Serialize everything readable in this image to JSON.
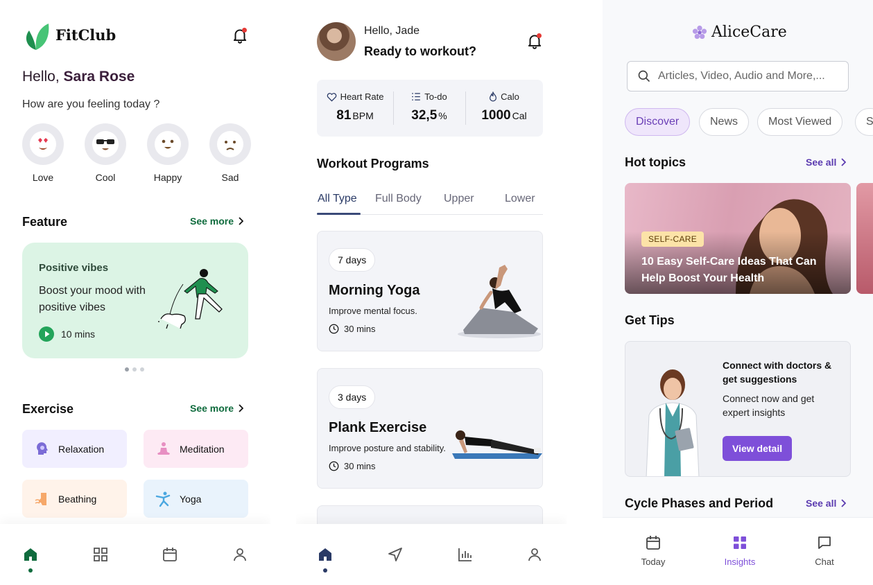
{
  "fitclub": {
    "brand": "FitClub",
    "greeting_prefix": "Hello, ",
    "user_name": "Sara Rose",
    "feeling_question": "How are you feeling today ?",
    "moods": [
      "Love",
      "Cool",
      "Happy",
      "Sad"
    ],
    "feature": {
      "section_title": "Feature",
      "see_more": "See more",
      "card_title": "Positive vibes",
      "card_desc": "Boost your mood with positive vibes",
      "duration": "10 mins"
    },
    "exercise": {
      "section_title": "Exercise",
      "see_more": "See more",
      "items": [
        "Relaxation",
        "Meditation",
        "Beathing",
        "Yoga"
      ]
    },
    "colors": {
      "brand_green": "#0f6b3d",
      "feature_bg": "#dcf4e5"
    },
    "icons": [
      "leaf-logo-icon",
      "bell-icon",
      "home-icon",
      "grid-icon",
      "calendar-icon",
      "profile-icon"
    ]
  },
  "workout": {
    "greeting": "Hello, Jade",
    "subtitle": "Ready to workout?",
    "stats": [
      {
        "label": "Heart Rate",
        "value": "81",
        "unit": "BPM"
      },
      {
        "label": "To-do",
        "value": "32,5",
        "unit": "%"
      },
      {
        "label": "Calo",
        "value": "1000",
        "unit": "Cal"
      }
    ],
    "programs_title": "Workout Programs",
    "tabs": [
      "All Type",
      "Full Body",
      "Upper",
      "Lower"
    ],
    "cards": [
      {
        "days": "7 days",
        "title": "Morning Yoga",
        "subtitle": "Improve mental focus.",
        "duration": "30 mins"
      },
      {
        "days": "3 days",
        "title": "Plank Exercise",
        "subtitle": "Improve posture and stability.",
        "duration": "30 mins"
      }
    ],
    "icons": [
      "heart-icon",
      "list-icon",
      "flame-icon",
      "clock-icon",
      "home-icon",
      "navigation-icon",
      "chart-icon",
      "profile-icon"
    ]
  },
  "alicecare": {
    "brand": "AliceCare",
    "search_placeholder": "Articles, Video, Audio and More,...",
    "chips": [
      "Discover",
      "News",
      "Most Viewed",
      "S"
    ],
    "hot_topics": {
      "title": "Hot topics",
      "see_all": "See all",
      "badge": "SELF-CARE",
      "headline": "10 Easy Self-Care Ideas That Can Help Boost Your Health"
    },
    "tips": {
      "title": "Get Tips",
      "card_title": "Connect with doctors & get suggestions",
      "card_desc": "Connect now and get expert insights",
      "button": "View detail"
    },
    "cycle": {
      "title": "Cycle Phases and Period",
      "see_all": "See all"
    },
    "tabs": [
      "Today",
      "Insights",
      "Chat"
    ],
    "colors": {
      "accent": "#7e4fd9",
      "badge": "#fce3a8"
    }
  }
}
